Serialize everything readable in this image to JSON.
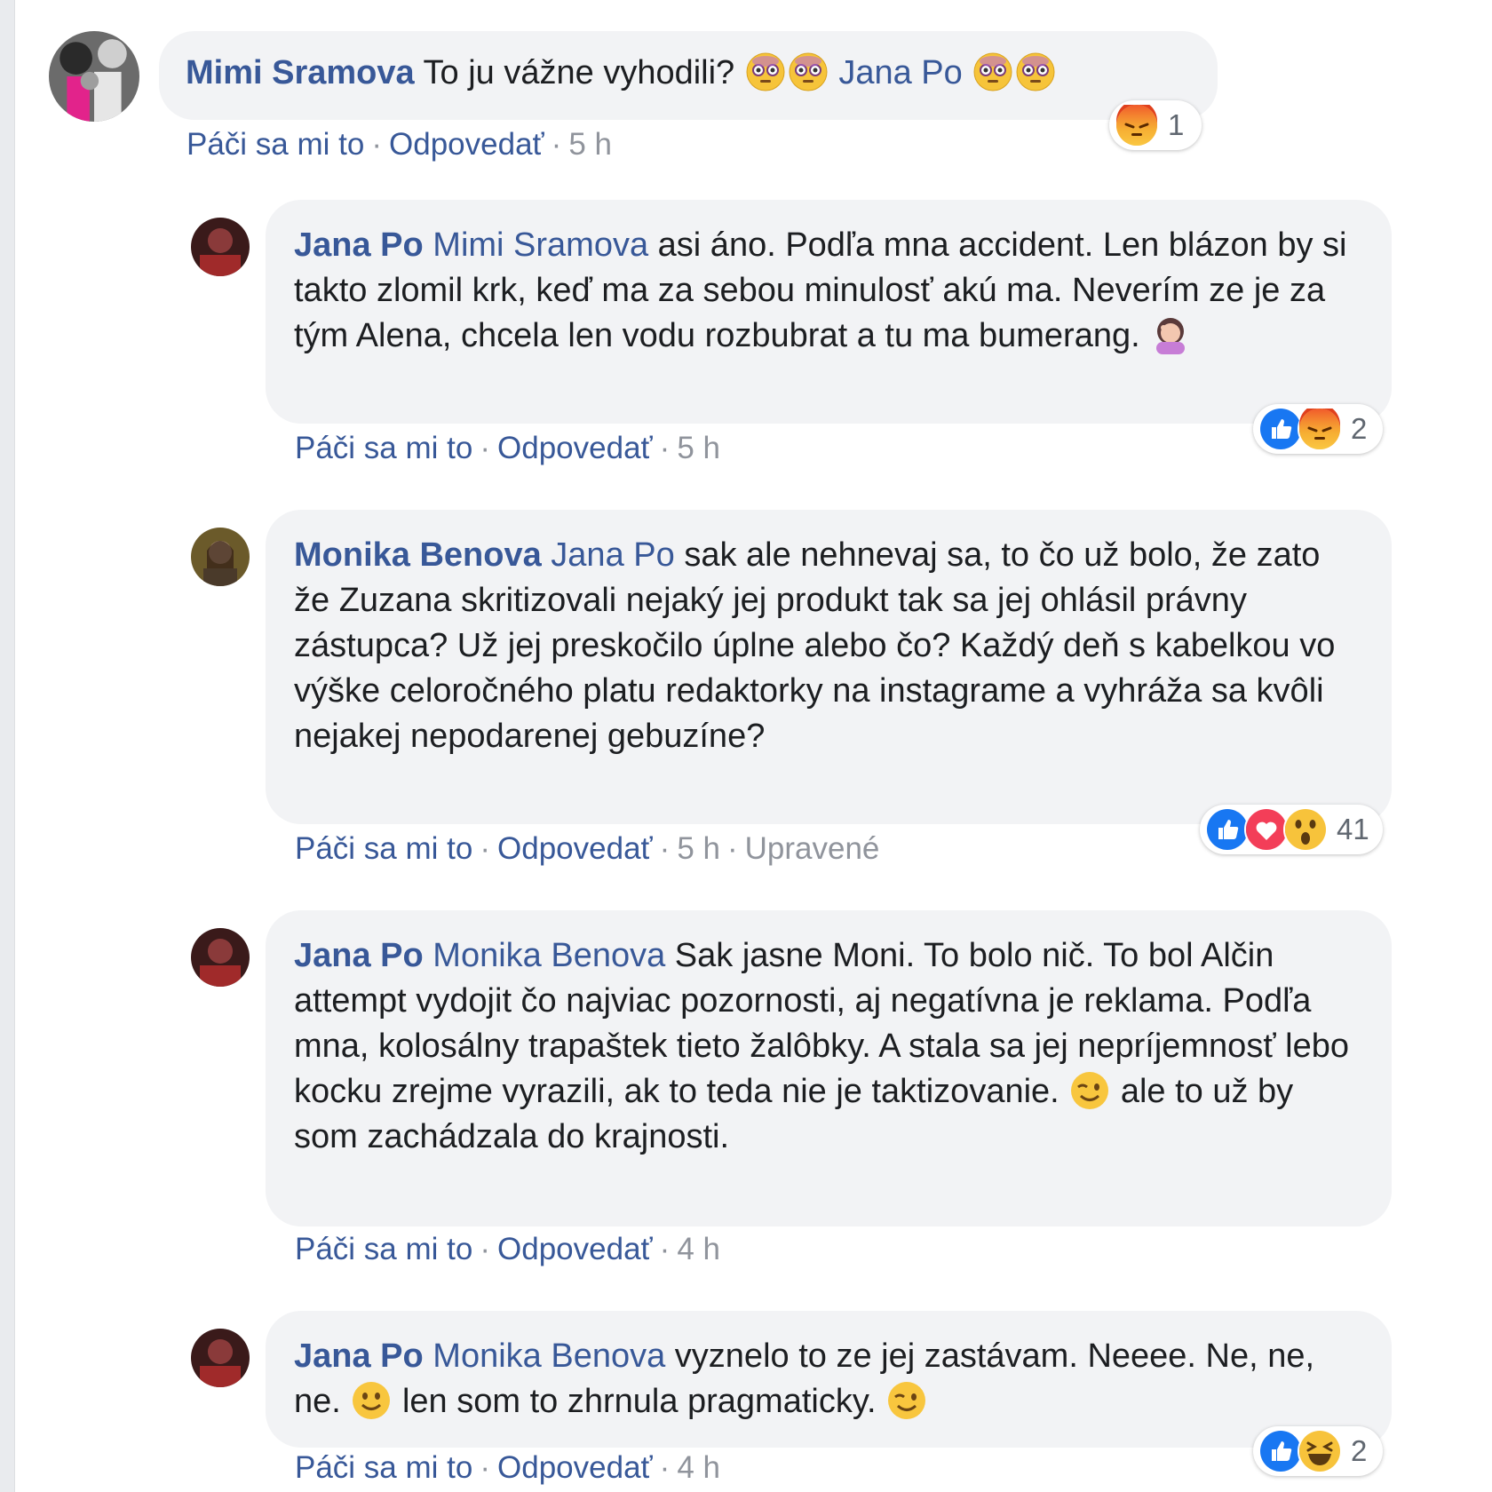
{
  "colors": {
    "link": "#385898",
    "meta": "#90949c",
    "bubble": "#f2f3f5",
    "like": "#1877f2",
    "love": "#f33e58",
    "angry": "#e9710f"
  },
  "comments": [
    {
      "author": "Mimi Sramova",
      "parts": [
        "To ju vážne vyhodili?",
        "Jana Po"
      ],
      "emojis": [
        "flushed-emoji",
        "flushed-emoji",
        "flushed-emoji",
        "flushed-emoji"
      ],
      "actions": {
        "like": "Páči sa mi to",
        "reply": "Odpovedať",
        "time": "5 h"
      },
      "reactions": {
        "icons": [
          "angry-reaction-icon"
        ],
        "count": "1"
      }
    },
    {
      "author": "Jana Po",
      "mention": "Mimi Sramova",
      "text": "asi áno. Podľa mna accident. Len blázon by si takto zlomil krk, keď ma za sebou minulosť akú ma. Neverím ze je za tým Alena, chcela len vodu rozbubrat a tu ma bumerang.",
      "emojis": [
        "facepalm-emoji"
      ],
      "actions": {
        "like": "Páči sa mi to",
        "reply": "Odpovedať",
        "time": "5 h"
      },
      "reactions": {
        "icons": [
          "like-reaction-icon",
          "angry-reaction-icon"
        ],
        "count": "2"
      }
    },
    {
      "author": "Monika Benova",
      "mention": "Jana Po",
      "text": "sak ale nehnevaj sa, to čo už bolo, že zato že Zuzana skritizovali nejaký jej produkt tak sa jej ohlásil právny zástupca? Už jej preskočilo úplne alebo čo? Každý deň s kabelkou vo výške celoročného platu redaktorky na instagrame a vyhráža sa kvôli nejakej nepodarenej gebuzíne?",
      "actions": {
        "like": "Páči sa mi to",
        "reply": "Odpovedať",
        "time": "5 h",
        "edited": "Upravené"
      },
      "reactions": {
        "icons": [
          "like-reaction-icon",
          "love-reaction-icon",
          "wow-reaction-icon"
        ],
        "count": "41"
      }
    },
    {
      "author": "Jana Po",
      "mention": "Monika Benova",
      "text1": "Sak jasne Moni. To bolo nič. To bol Alčin attempt vydojit čo najviac pozornosti, aj negatívna je reklama. Podľa mna, kolosálny trapaštek tieto žalôbky. A stala sa jej nepríjemnosť lebo kocku zrejme vyrazili, ak to teda nie je taktizovanie.",
      "text2": "ale to už by som zachádzala do krajnosti.",
      "emojis": [
        "wink-emoji"
      ],
      "actions": {
        "like": "Páči sa mi to",
        "reply": "Odpovedať",
        "time": "4 h"
      }
    },
    {
      "author": "Jana Po",
      "mention": "Monika Benova",
      "text1": "vyznelo to ze jej zastávam. Neeee. Ne, ne, ne.",
      "text2": "len som to zhrnula pragmaticky.",
      "emojis": [
        "smile-emoji",
        "wink-emoji"
      ],
      "actions": {
        "like": "Páči sa mi to",
        "reply": "Odpovedať",
        "time": "4 h"
      },
      "reactions": {
        "icons": [
          "like-reaction-icon",
          "laugh-reaction-icon"
        ],
        "count": "2"
      }
    }
  ]
}
